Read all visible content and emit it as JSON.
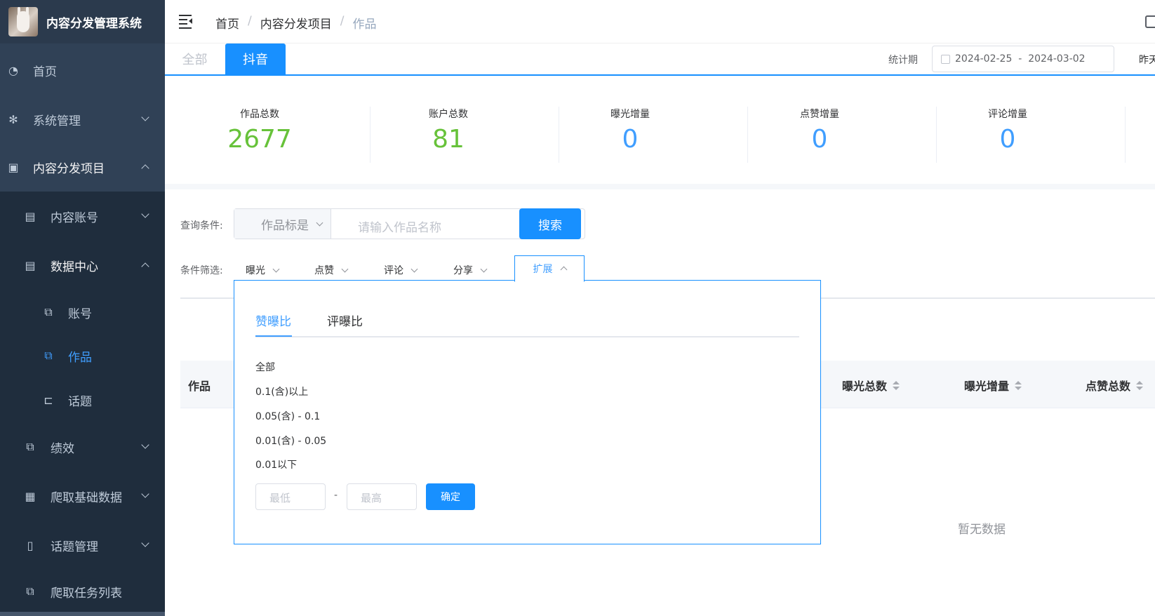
{
  "app": {
    "title": "内容分发管理系统"
  },
  "sidebar": {
    "items": [
      {
        "label": "首页",
        "icon": "dashboard-icon"
      },
      {
        "label": "系统管理",
        "icon": "gear-icon"
      },
      {
        "label": "内容分发项目",
        "icon": "briefcase-icon"
      },
      {
        "label": "内容账号",
        "icon": "document-icon"
      },
      {
        "label": "数据中心",
        "icon": "document-icon"
      },
      {
        "label": "账号",
        "icon": "puzzle-icon"
      },
      {
        "label": "作品",
        "icon": "puzzle-icon"
      },
      {
        "label": "话题",
        "icon": "tree-icon"
      },
      {
        "label": "绩效",
        "icon": "puzzle-icon"
      },
      {
        "label": "爬取基础数据",
        "icon": "chart-icon"
      },
      {
        "label": "话题管理",
        "icon": "book-icon"
      },
      {
        "label": "爬取任务列表",
        "icon": "puzzle-icon"
      }
    ]
  },
  "breadcrumb": {
    "home": "首页",
    "sep": "/",
    "project": "内容分发项目",
    "current": "作品"
  },
  "tabs": {
    "all": "全部",
    "douyin": "抖音"
  },
  "period": {
    "label": "统计期",
    "range": "2024-02-25  -  2024-03-02",
    "yesterday": "昨天"
  },
  "stats": [
    {
      "label": "作品总数",
      "value": "2677"
    },
    {
      "label": "账户总数",
      "value": "81"
    },
    {
      "label": "曝光增量",
      "value": "0"
    },
    {
      "label": "点赞增量",
      "value": "0"
    },
    {
      "label": "评论增量",
      "value": "0"
    }
  ],
  "query": {
    "label": "查询条件:",
    "select_value": "作品标是",
    "placeholder": "请输入作品名称",
    "search_label": "搜索"
  },
  "filter": {
    "label": "条件筛选:",
    "items": [
      "曝光",
      "点赞",
      "评论",
      "分享",
      "扩展"
    ]
  },
  "popover": {
    "tabs": [
      "赞曝比",
      "评曝比"
    ],
    "options": [
      "全部",
      "0.1(含)以上",
      "0.05(含) - 0.1",
      "0.01(含) - 0.05",
      "0.01以下"
    ],
    "min_placeholder": "最低",
    "max_placeholder": "最高",
    "dash": "-",
    "confirm": "确定"
  },
  "table": {
    "headers": [
      "作品",
      "曝光总数",
      "曝光增量",
      "点赞总数"
    ],
    "empty_text": "暂无数据"
  },
  "colors": {
    "primary": "#1890ff",
    "sidebar": "#304156",
    "green": "#67c23a"
  }
}
